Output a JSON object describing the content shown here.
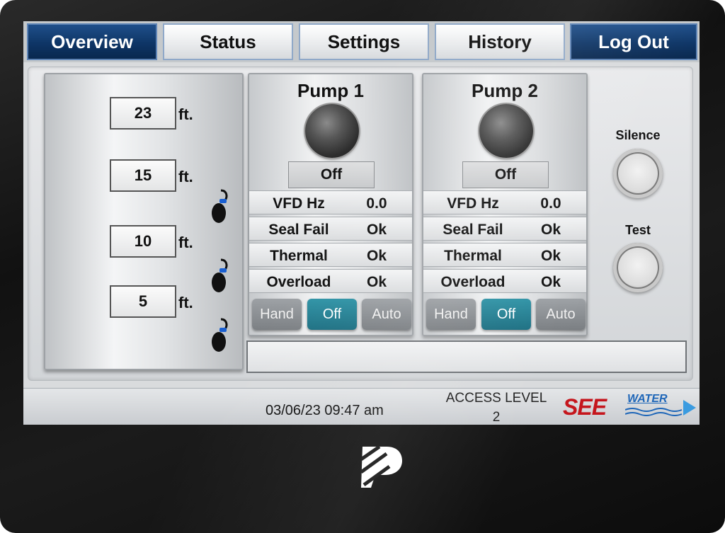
{
  "nav": {
    "tabs": [
      {
        "label": "Overview",
        "active": true
      },
      {
        "label": "Status",
        "active": false
      },
      {
        "label": "Settings",
        "active": false
      },
      {
        "label": "History",
        "active": false
      },
      {
        "label": "Log Out",
        "active": false
      }
    ]
  },
  "tank": {
    "unit": "ft.",
    "levels": [
      "23",
      "15",
      "10",
      "5"
    ]
  },
  "pumps": [
    {
      "title": "Pump 1",
      "state": "Off",
      "rows": [
        {
          "label": "VFD Hz",
          "value": "0.0"
        },
        {
          "label": "Seal Fail",
          "value": "Ok"
        },
        {
          "label": "Thermal",
          "value": "Ok"
        },
        {
          "label": "Overload",
          "value": "Ok"
        }
      ],
      "modes": [
        "Hand",
        "Off",
        "Auto"
      ],
      "active_mode": "Off"
    },
    {
      "title": "Pump 2",
      "state": "Off",
      "rows": [
        {
          "label": "VFD Hz",
          "value": "0.0"
        },
        {
          "label": "Seal Fail",
          "value": "Ok"
        },
        {
          "label": "Thermal",
          "value": "Ok"
        },
        {
          "label": "Overload",
          "value": "Ok"
        }
      ],
      "modes": [
        "Hand",
        "Off",
        "Auto"
      ],
      "active_mode": "Off"
    }
  ],
  "alarm": {
    "silence_label": "Silence",
    "test_label": "Test"
  },
  "message_bar": {
    "text": ""
  },
  "footer": {
    "datetime": "03/06/23 09:47 am",
    "access_title": "ACCESS LEVEL",
    "access_value": "2",
    "logo_see": "SEE",
    "logo_water": "WATER"
  },
  "colors": {
    "nav_active": "#0e3566",
    "mode_active": "#1c6f82",
    "logo_red": "#c5161d",
    "logo_blue": "#1e66b8"
  }
}
